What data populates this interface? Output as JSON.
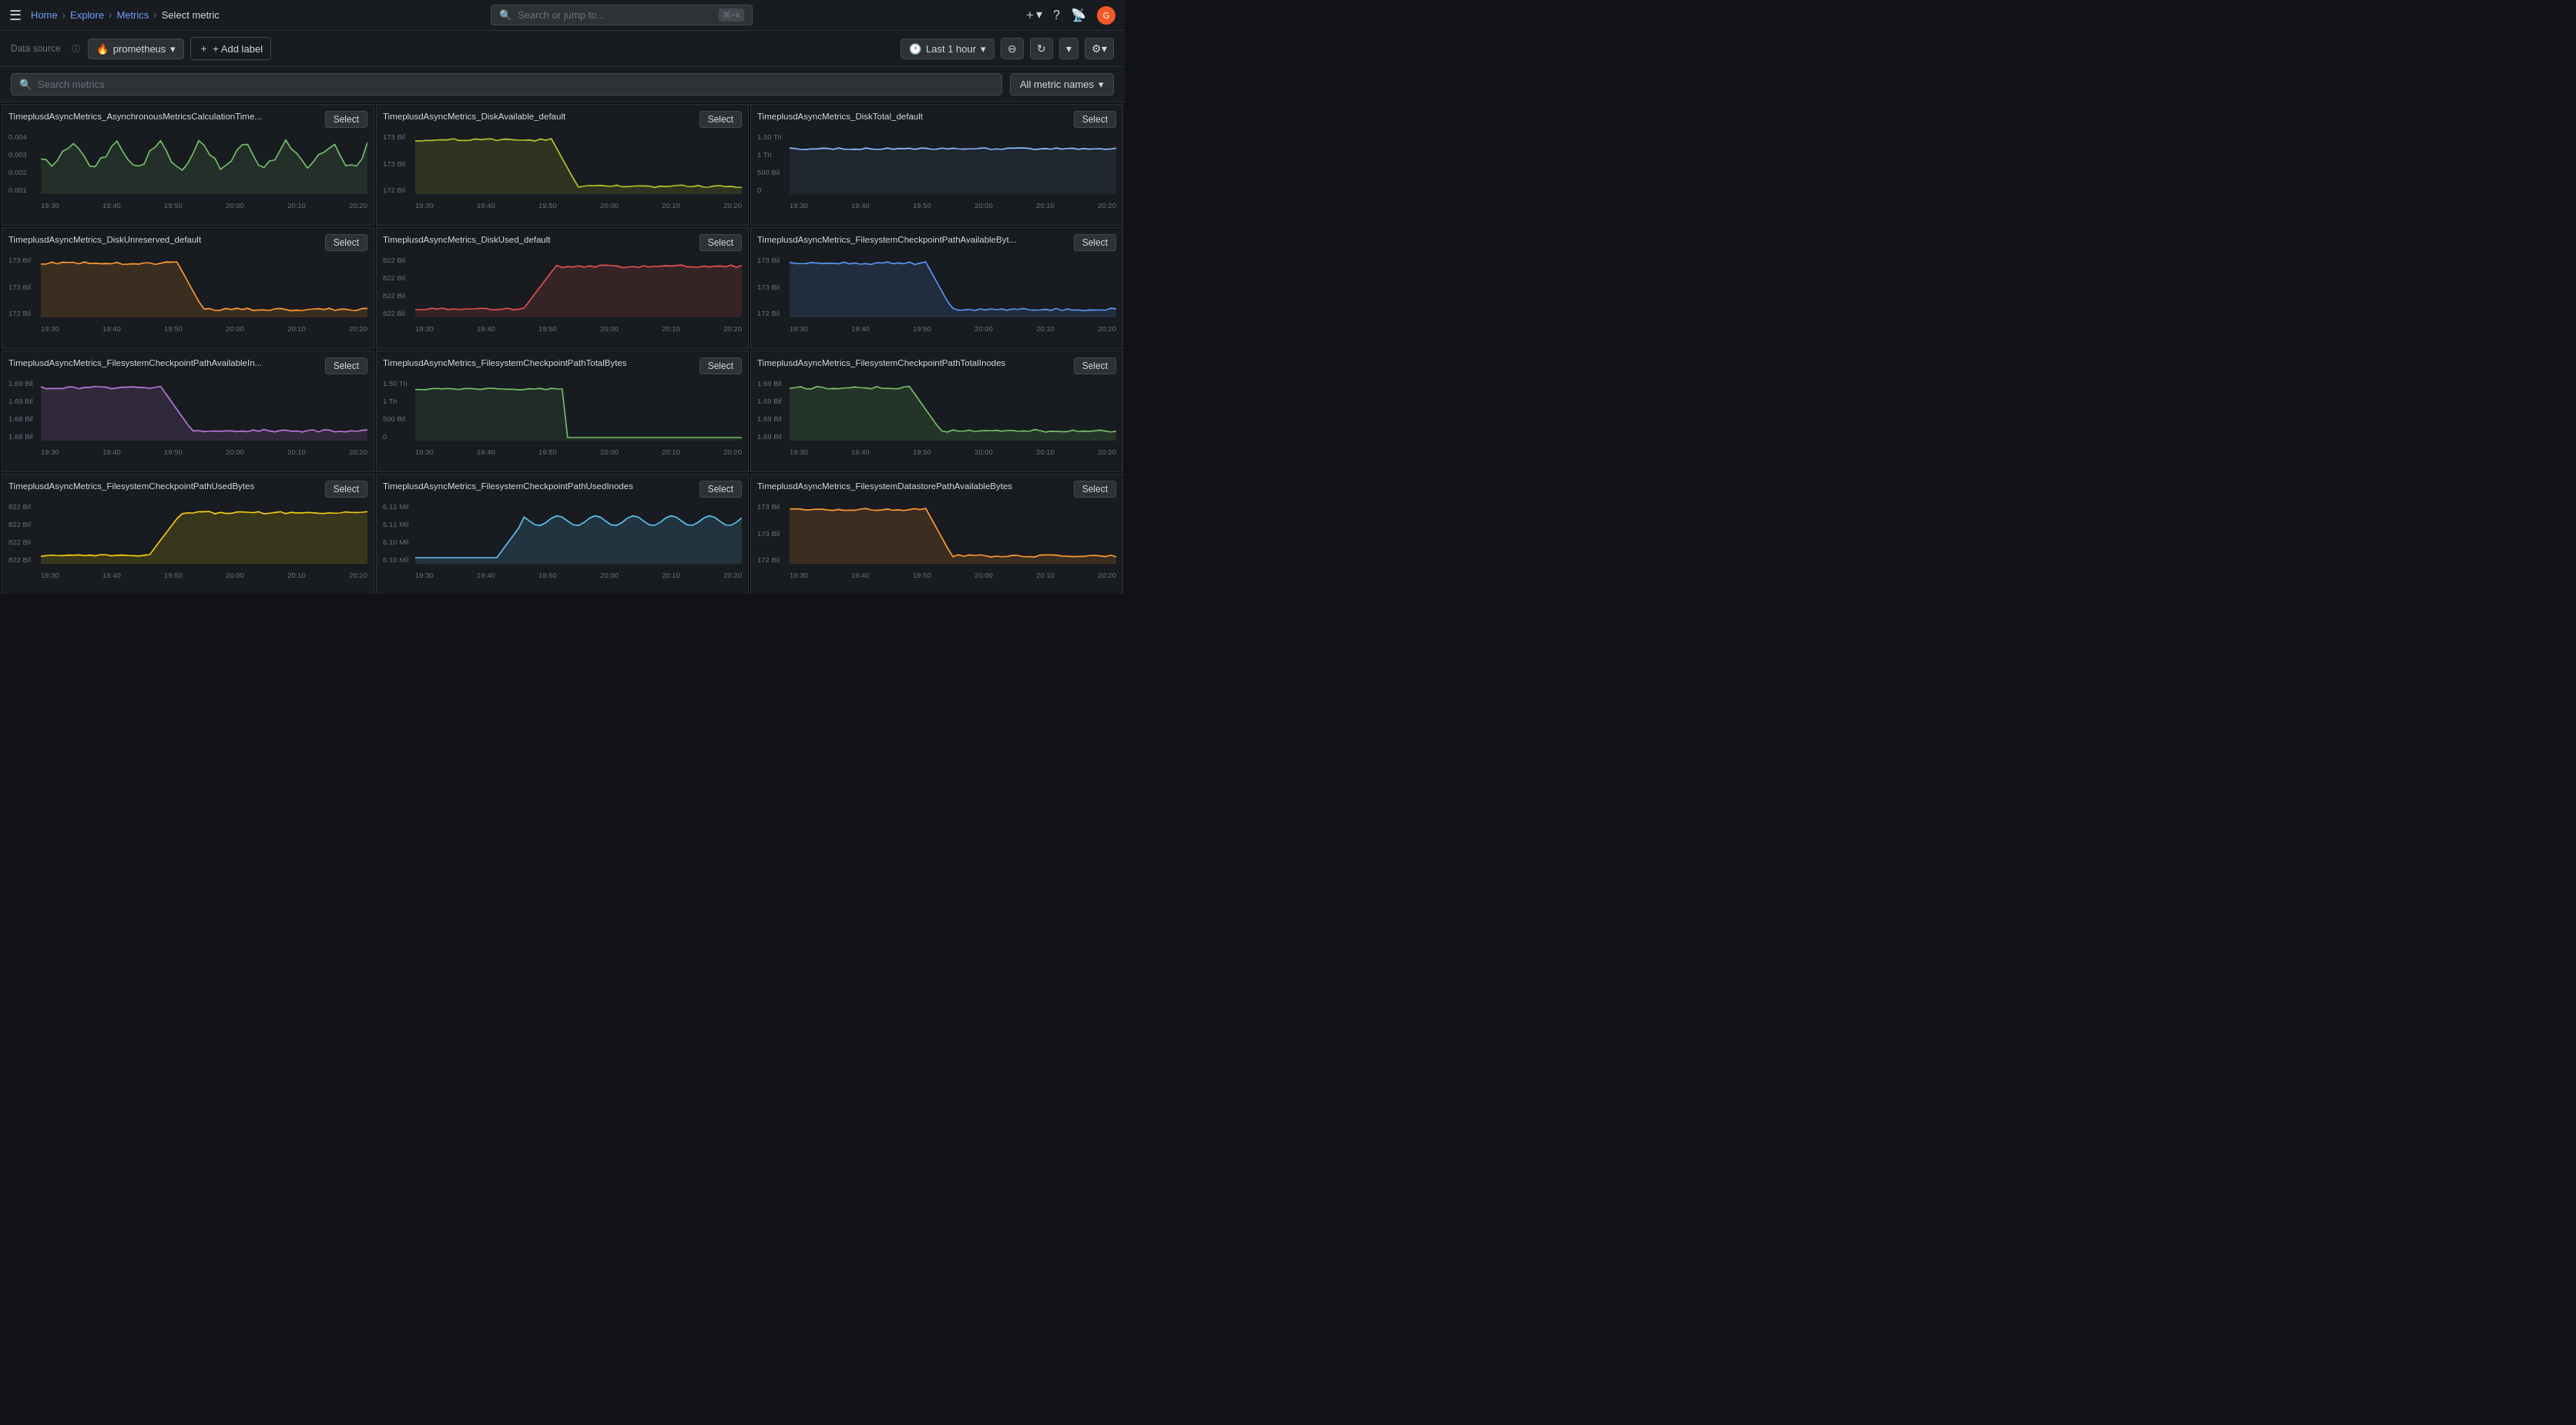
{
  "topnav": {
    "hamburger": "☰",
    "breadcrumbs": [
      "Home",
      "Explore",
      "Metrics",
      "Select metric"
    ],
    "search_placeholder": "Search or jump to...",
    "search_shortcut": "⌘+k",
    "icons": [
      "plus",
      "help",
      "bell",
      "avatar"
    ]
  },
  "toolbar": {
    "datasource_label": "Data source",
    "datasource_info": "ⓘ",
    "datasource_value": "prometheus",
    "add_label": "+ Add label",
    "time_label": "Last 1 hour",
    "zoom_icon": "⊖",
    "refresh_icon": "↻",
    "settings_icon": "⚙"
  },
  "search": {
    "placeholder": "Search metrics",
    "filter_label": "All metric names"
  },
  "accent": "#f05a28",
  "time_labels": [
    "19:30",
    "19:40",
    "19:50",
    "20:00",
    "20:10",
    "20:20"
  ],
  "metrics": [
    {
      "title": "TimeplusdAsyncMetrics_AsynchronousMetricsCalculationTime...",
      "select": "Select",
      "y_labels": [
        "0.004",
        "0.003",
        "0.002",
        "0.001"
      ],
      "color": "#73bf69",
      "bg": "rgba(115,191,105,0.12)",
      "type": "volatile_low"
    },
    {
      "title": "TimeplusdAsyncMetrics_DiskAvailable_default",
      "select": "Select",
      "y_labels": [
        "173 Bil",
        "173 Bil",
        "172 Bil"
      ],
      "color": "#b5c32a",
      "bg": "rgba(181,195,42,0.15)",
      "type": "drop"
    },
    {
      "title": "TimeplusdAsyncMetrics_DiskTotal_default",
      "select": "Select",
      "y_labels": [
        "1.50 Tri",
        "1 Tri",
        "500 Bil",
        "0"
      ],
      "color": "#8AB8FF",
      "bg": "rgba(138,184,255,0.07)",
      "type": "flat_high"
    },
    {
      "title": "TimeplusdAsyncMetrics_DiskUnreserved_default",
      "select": "Select",
      "y_labels": [
        "173 Bil",
        "173 Bil",
        "172 Bil"
      ],
      "color": "#FF9830",
      "bg": "rgba(255,152,48,0.15)",
      "type": "drop"
    },
    {
      "title": "TimeplusdAsyncMetrics_DiskUsed_default",
      "select": "Select",
      "y_labels": [
        "822 Bil",
        "822 Bil",
        "822 Bil",
        "822 Bil"
      ],
      "color": "#e05252",
      "bg": "rgba(224,82,82,0.15)",
      "type": "rise"
    },
    {
      "title": "TimeplusdAsyncMetrics_FilesystemCheckpointPathAvailableByt...",
      "select": "Select",
      "y_labels": [
        "173 Bil",
        "173 Bil",
        "172 Bil"
      ],
      "color": "#5794F2",
      "bg": "rgba(87,148,242,0.15)",
      "type": "drop"
    },
    {
      "title": "TimeplusdAsyncMetrics_FilesystemCheckpointPathAvailableIn...",
      "select": "Select",
      "y_labels": [
        "1.69 Bil",
        "1.69 Bil",
        "1.68 Bil",
        "1.68 Bil"
      ],
      "color": "#b877d9",
      "bg": "rgba(184,119,217,0.15)",
      "type": "drop_smooth"
    },
    {
      "title": "TimeplusdAsyncMetrics_FilesystemCheckpointPathTotalBytes",
      "select": "Select",
      "y_labels": [
        "1.50 Tri",
        "1 Tri",
        "500 Bil",
        "0"
      ],
      "color": "#73bf69",
      "bg": "rgba(115,191,105,0.1)",
      "type": "flat_then_zero"
    },
    {
      "title": "TimeplusdAsyncMetrics_FilesystemCheckpointPathTotalInodes",
      "select": "Select",
      "y_labels": [
        "1.69 Bil",
        "1.69 Bil",
        "1.69 Bil",
        "1.69 Bil"
      ],
      "color": "#73bf69",
      "bg": "rgba(115,191,105,0.15)",
      "type": "drop_smooth"
    },
    {
      "title": "TimeplusdAsyncMetrics_FilesystemCheckpointPathUsedBytes",
      "select": "Select",
      "y_labels": [
        "822 Bil",
        "822 Bil",
        "822 Bil",
        "822 Bil"
      ],
      "color": "#F2CC0C",
      "bg": "rgba(242,204,12,0.15)",
      "type": "rise"
    },
    {
      "title": "TimeplusdAsyncMetrics_FilesystemCheckpointPathUsedInodes",
      "select": "Select",
      "y_labels": [
        "6.11 Mil",
        "6.11 Mil",
        "6.10 Mil",
        "6.10 Mil"
      ],
      "color": "#5bc4f5",
      "bg": "rgba(91,196,245,0.15)",
      "type": "step_rise"
    },
    {
      "title": "TimeplusdAsyncMetrics_FilesystemDatastorePathAvailableBytes",
      "select": "Select",
      "y_labels": [
        "173 Bil",
        "173 Bil",
        "172 Bil"
      ],
      "color": "#FF9830",
      "bg": "rgba(255,152,48,0.15)",
      "type": "drop"
    }
  ]
}
